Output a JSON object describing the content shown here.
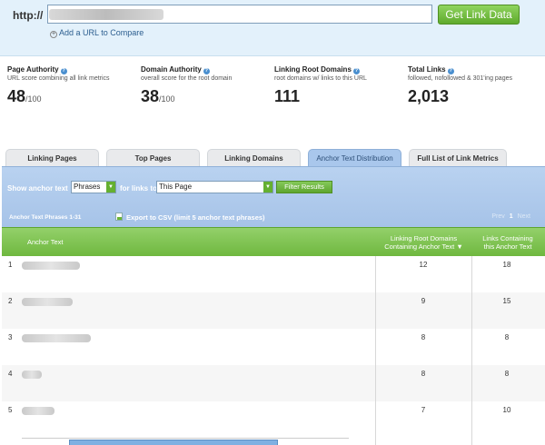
{
  "search": {
    "protocol_label": "http://",
    "url_value": "",
    "submit_label": "Get Link Data",
    "add_url_label": "Add a URL to Compare"
  },
  "metrics": [
    {
      "title": "Page Authority",
      "subtitle": "URL score combining all link metrics",
      "value": "48",
      "denom": "/100"
    },
    {
      "title": "Domain Authority",
      "subtitle": "overall score for the root domain",
      "value": "38",
      "denom": "/100"
    },
    {
      "title": "Linking Root Domains",
      "subtitle": "root domains w/ links to this URL",
      "value": "111",
      "denom": ""
    },
    {
      "title": "Total Links",
      "subtitle": "followed, nofollowed & 301'ing pages",
      "value": "2,013",
      "denom": ""
    }
  ],
  "tabs": [
    {
      "label": "Linking Pages",
      "active": false
    },
    {
      "label": "Top Pages",
      "active": false
    },
    {
      "label": "Linking Domains",
      "active": false
    },
    {
      "label": "Anchor Text Distribution",
      "active": true
    },
    {
      "label": "Full List of Link Metrics",
      "active": false
    }
  ],
  "filter": {
    "show_label": "Show anchor text",
    "type_selected": "Phrases",
    "for_links_label": "for links to",
    "scope_selected": "This Page",
    "button_label": "Filter Results",
    "count_label": "Anchor Text Phrases 1-31",
    "export_label": "Export to CSV (limit 5 anchor text phrases)",
    "pager": {
      "prev": "Prev",
      "current": "1",
      "next": "Next"
    }
  },
  "table": {
    "headers": {
      "anchor": "Anchor Text",
      "lrd_line1": "Linking Root Domains",
      "lrd_line2": "Containing Anchor Text ▼",
      "links_line1": "Links Containing",
      "links_line2": "this Anchor Text"
    },
    "rows": [
      {
        "num": "1",
        "lrd": "12",
        "links": "18"
      },
      {
        "num": "2",
        "lrd": "9",
        "links": "15"
      },
      {
        "num": "3",
        "lrd": "8",
        "links": "8"
      },
      {
        "num": "4",
        "lrd": "8",
        "links": "8"
      },
      {
        "num": "5",
        "lrd": "7",
        "links": "10"
      }
    ]
  },
  "colors": {
    "accent_green": "#65b031",
    "tab_active": "#a9c7ec",
    "header_bg": "#e3f1fb"
  }
}
